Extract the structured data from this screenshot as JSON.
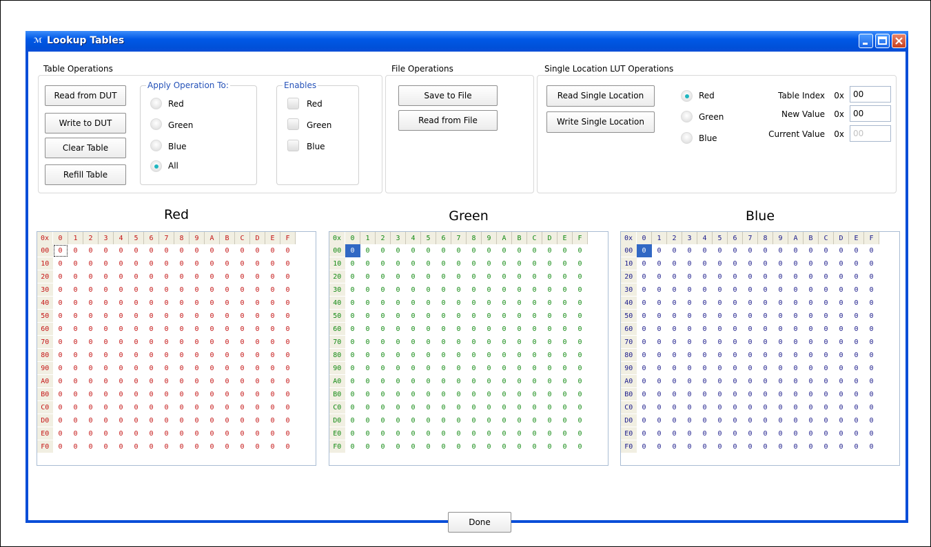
{
  "window": {
    "title": "Lookup Tables",
    "icon": "maxim-logo-icon"
  },
  "table_operations": {
    "title": "Table Operations",
    "buttons": [
      "Read from DUT",
      "Write to DUT",
      "Clear Table",
      "Refill Table"
    ],
    "apply_operation": {
      "legend": "Apply Operation To:",
      "options": [
        "Red",
        "Green",
        "Blue",
        "All"
      ],
      "selected": "All"
    },
    "enables": {
      "legend": "Enables",
      "options": [
        "Red",
        "Green",
        "Blue"
      ],
      "checked": []
    }
  },
  "file_operations": {
    "title": "File Operations",
    "save_label": "Save to File",
    "read_label": "Read from File"
  },
  "single_location": {
    "title": "Single Location LUT Operations",
    "read_label": "Read Single Location",
    "write_label": "Write Single Location",
    "channels": [
      "Red",
      "Green",
      "Blue"
    ],
    "selected_channel": "Red",
    "table_index_label": "Table Index",
    "new_value_label": "New Value",
    "current_value_label": "Current Value",
    "prefix": "0x",
    "table_index": "00",
    "new_value": "00",
    "current_value": "00"
  },
  "tables": {
    "corner": "0x",
    "columns": [
      "0",
      "1",
      "2",
      "3",
      "4",
      "5",
      "6",
      "7",
      "8",
      "9",
      "A",
      "B",
      "C",
      "D",
      "E",
      "F"
    ],
    "rows": [
      "00",
      "10",
      "20",
      "30",
      "40",
      "50",
      "60",
      "70",
      "80",
      "90",
      "A0",
      "B0",
      "C0",
      "D0",
      "E0",
      "F0"
    ],
    "cell_value": "0",
    "red_title": "Red",
    "green_title": "Green",
    "blue_title": "Blue",
    "colors": {
      "red": "#c41414",
      "green": "#138a13",
      "blue": "#1a1a8a",
      "selection": "#3168c4"
    }
  },
  "done_label": "Done",
  "colors": {
    "titlebar": "#0058e6",
    "accent_radio": "#1fb6c0",
    "legend": "#2451b8"
  }
}
